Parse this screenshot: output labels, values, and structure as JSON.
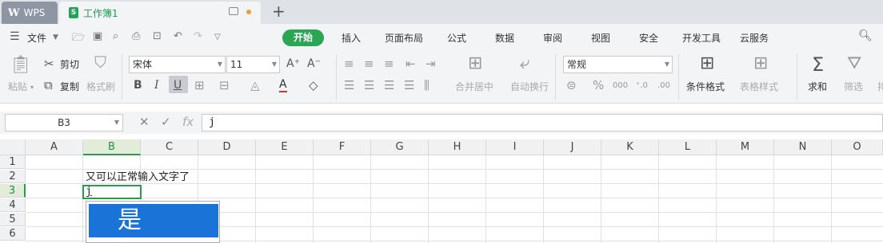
{
  "tabs": {
    "wps_label": "WPS",
    "doc_title": "工作簿1",
    "add_label": "+"
  },
  "menu": {
    "file": "文件",
    "start": "开始",
    "items": [
      "插入",
      "页面布局",
      "公式",
      "数据",
      "审阅",
      "视图",
      "安全",
      "开发工具",
      "云服务"
    ]
  },
  "ribbon": {
    "paste": "粘贴",
    "cut": "剪切",
    "copy": "复制",
    "format_painter": "格式刷",
    "font_name": "宋体",
    "font_size": "11",
    "merge_center": "合并居中",
    "auto_wrap": "自动换行",
    "number_format": "常规",
    "conditional_format": "条件格式",
    "table_style": "表格样式",
    "sum": "求和",
    "filter": "筛选",
    "sort_partial": "排"
  },
  "formula_bar": {
    "cell_ref": "B3",
    "content": "j"
  },
  "columns": [
    "A",
    "B",
    "C",
    "D",
    "E",
    "F",
    "G",
    "H",
    "I",
    "J",
    "K",
    "L",
    "M",
    "N",
    "O"
  ],
  "rows": [
    "1",
    "2",
    "3",
    "4",
    "5",
    "6"
  ],
  "cells": {
    "B2": "又可以正常输入文字了",
    "B3": "j"
  },
  "ime": {
    "candidate": "是"
  },
  "colors": {
    "accent_green": "#2aa654",
    "ime_blue": "#1a73d6"
  }
}
